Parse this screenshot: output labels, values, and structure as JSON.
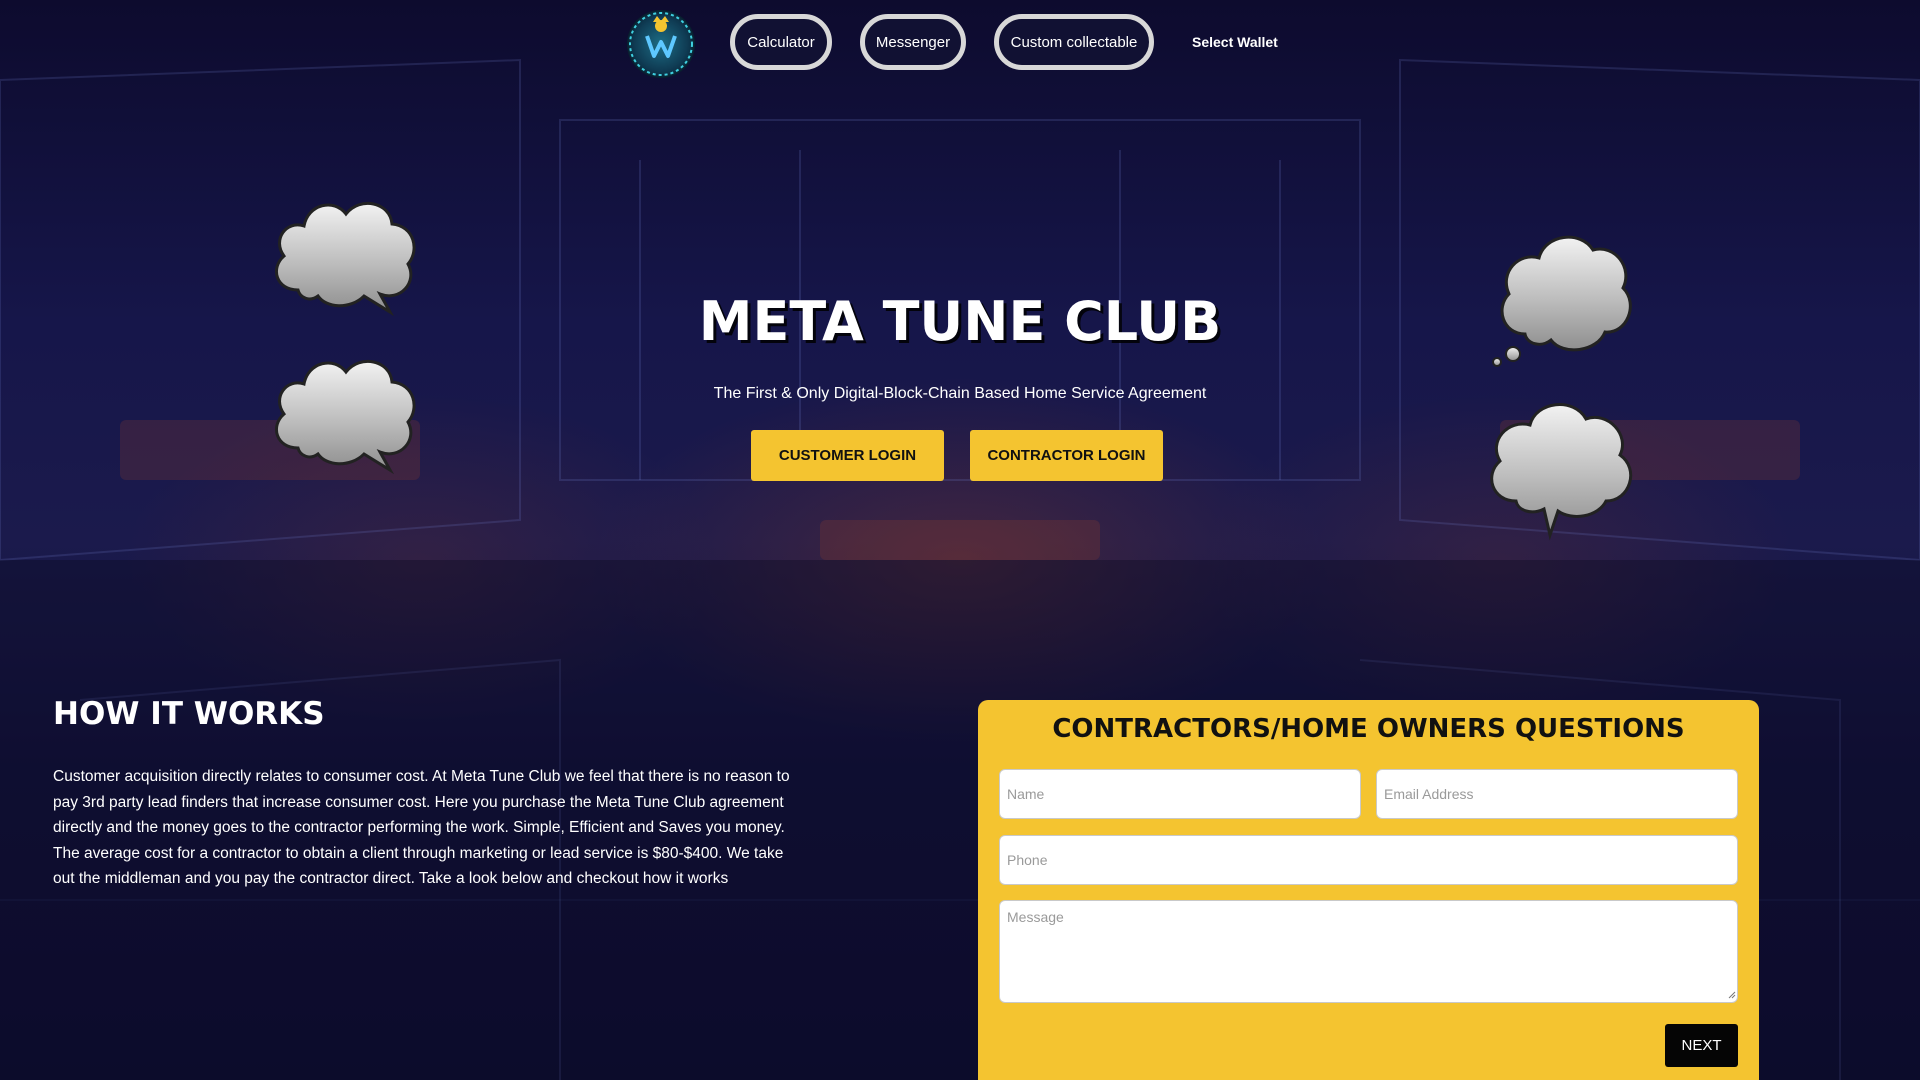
{
  "nav": {
    "logo_icon": "meta-tune-club-logo",
    "items": [
      {
        "label": "Calculator"
      },
      {
        "label": "Messenger"
      },
      {
        "label": "Custom collectable"
      }
    ],
    "wallet_label": "Select Wallet"
  },
  "hero": {
    "title": "META TUNE CLUB",
    "subtitle": "The First & Only Digital-Block-Chain Based Home Service Agreement",
    "customer_login_label": "CUSTOMER LOGIN",
    "contractor_login_label": "CONTRACTOR LOGIN",
    "decorations": [
      "speech-cloud-icon",
      "thought-cloud-icon"
    ]
  },
  "how_it_works": {
    "title": "HOW IT WORKS",
    "lines": [
      "Customer acquisition directly relates to consumer cost. At Meta Tune Club we feel that there is no reason to",
      "pay 3rd party lead finders that increase consumer cost. Here you purchase the Meta Tune Club agreement",
      "directly and the money goes to the contractor performing the work. Simple, Efficient and Saves you money.",
      "The average cost for a contractor to obtain a client through marketing or lead service is $80-$400. We take",
      "out the middleman and you pay the contractor direct. Take a look below and checkout how it works"
    ]
  },
  "form": {
    "title": "CONTRACTORS/HOME OWNERS QUESTIONS",
    "name_placeholder": "Name",
    "email_placeholder": "Email Address",
    "phone_placeholder": "Phone",
    "message_placeholder": "Message",
    "next_label": "NEXT"
  },
  "colors": {
    "accent_yellow": "#f4c430",
    "background_navy": "#16164a",
    "next_button": "#050505"
  }
}
